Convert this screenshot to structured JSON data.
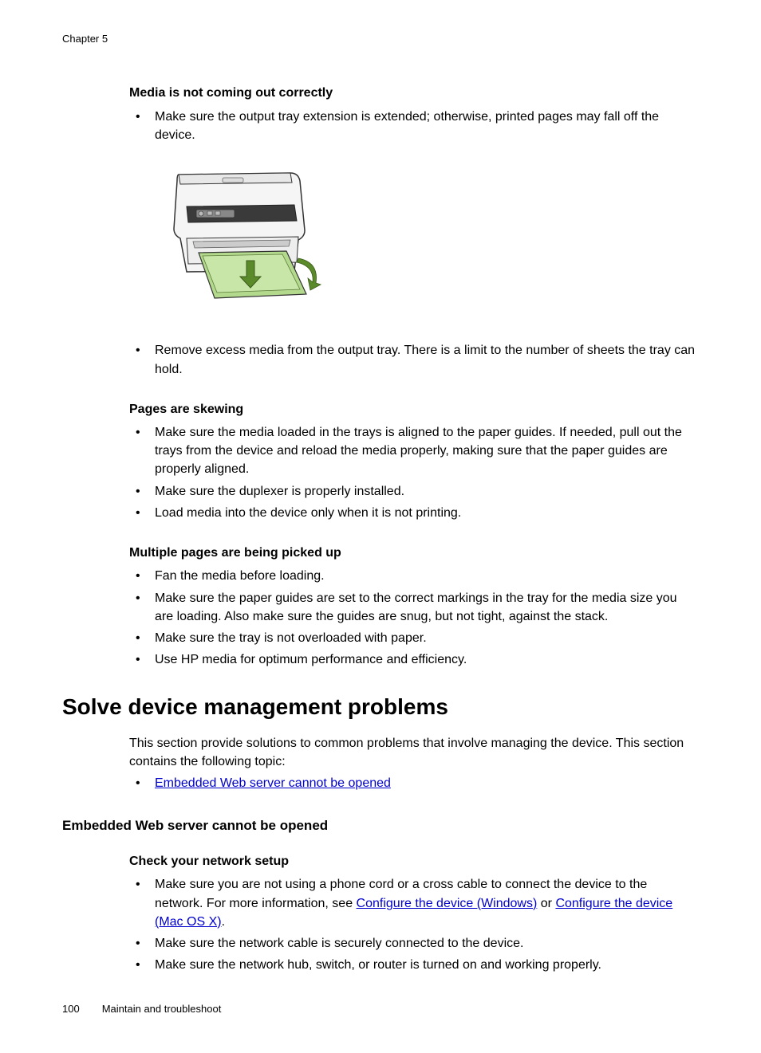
{
  "chapter": "Chapter 5",
  "section1": {
    "heading": "Media is not coming out correctly",
    "bullets": [
      "Make sure the output tray extension is extended; otherwise, printed pages may fall off the device.",
      "Remove excess media from the output tray. There is a limit to the number of sheets the tray can hold."
    ]
  },
  "section2": {
    "heading": "Pages are skewing",
    "bullets": [
      "Make sure the media loaded in the trays is aligned to the paper guides. If needed, pull out the trays from the device and reload the media properly, making sure that the paper guides are properly aligned.",
      "Make sure the duplexer is properly installed.",
      "Load media into the device only when it is not printing."
    ]
  },
  "section3": {
    "heading": "Multiple pages are being picked up",
    "bullets": [
      "Fan the media before loading.",
      "Make sure the paper guides are set to the correct markings in the tray for the media size you are loading. Also make sure the guides are snug, but not tight, against the stack.",
      "Make sure the tray is not overloaded with paper.",
      "Use HP media for optimum performance and efficiency."
    ]
  },
  "h1": "Solve device management problems",
  "intro": {
    "line1": "This section provide solutions to common problems that involve managing the device. This section contains the following topic:",
    "linkBullet": "Embedded Web server cannot be opened"
  },
  "h2": "Embedded Web server cannot be opened",
  "section4": {
    "heading": "Check your network setup",
    "bullet1_pre": "Make sure you are not using a phone cord or a cross cable to connect the device to the network. For more information, see ",
    "bullet1_link1": "Configure the device (Windows)",
    "bullet1_mid": " or ",
    "bullet1_link2": "Configure the device (Mac OS X)",
    "bullet1_post": ".",
    "bullet2": "Make sure the network cable is securely connected to the device.",
    "bullet3": "Make sure the network hub, switch, or router is turned on and working properly."
  },
  "footer": {
    "page": "100",
    "title": "Maintain and troubleshoot"
  }
}
